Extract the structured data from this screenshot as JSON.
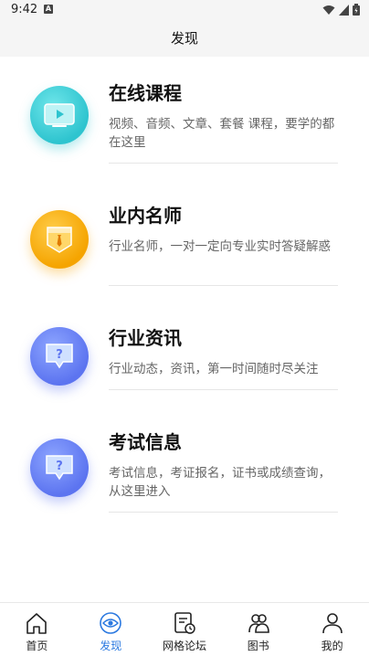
{
  "status_bar": {
    "time": "9:42",
    "notification_glyph": "A"
  },
  "header": {
    "title": "发现"
  },
  "items": [
    {
      "title": "在线课程",
      "desc": "视频、音频、文章、套餐 课程，要学的都在这里",
      "icon": "play-icon",
      "color": "#2ec4cf"
    },
    {
      "title": "业内名师",
      "desc": "行业名师，一对一定向专业实时答疑解惑",
      "icon": "teacher-badge-icon",
      "color": "#f5a400"
    },
    {
      "title": "行业资讯",
      "desc": "行业动态，资讯，第一时间随时尽关注",
      "icon": "question-bubble-icon",
      "color": "#5c74f0"
    },
    {
      "title": "考试信息",
      "desc": "考试信息，考证报名，证书或成绩查询，从这里进入",
      "icon": "question-bubble-icon",
      "color": "#5c74f0"
    }
  ],
  "tabs": [
    {
      "label": "首页",
      "icon": "home-icon",
      "active": false
    },
    {
      "label": "发现",
      "icon": "eye-icon",
      "active": true
    },
    {
      "label": "网格论坛",
      "icon": "forum-icon",
      "active": false
    },
    {
      "label": "图书",
      "icon": "people-icon",
      "active": false
    },
    {
      "label": "我的",
      "icon": "user-icon",
      "active": false
    }
  ],
  "colors": {
    "accent": "#2b79e0",
    "header_bg": "#f5f5f5"
  }
}
